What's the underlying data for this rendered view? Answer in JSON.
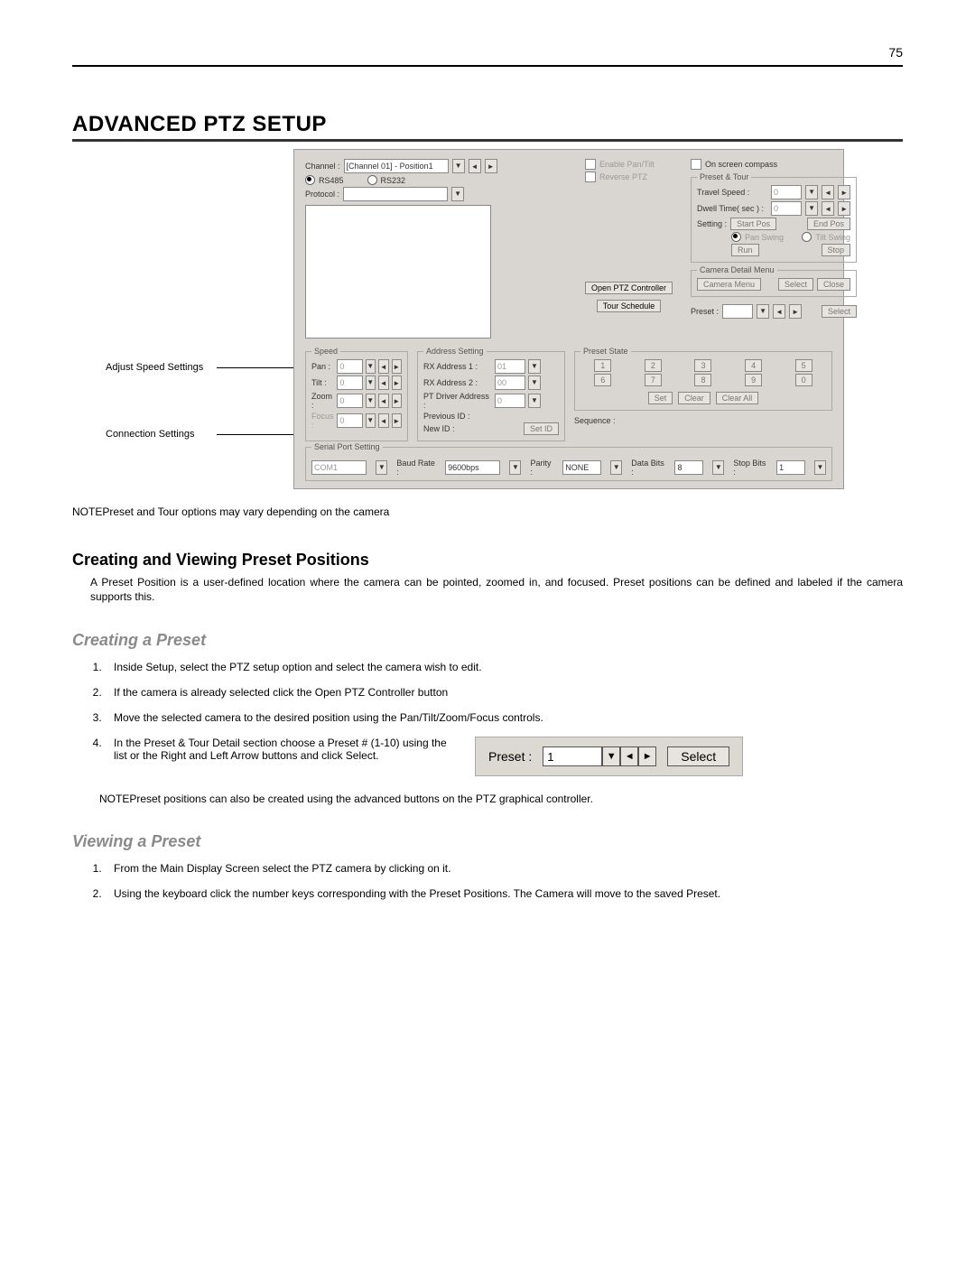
{
  "page_number": "75",
  "h1": "ADVANCED PTZ SETUP",
  "callouts": {
    "speed": "Adjust Speed Settings",
    "conn": "Connection Settings"
  },
  "panel": {
    "channel_label": "Channel :",
    "channel_value": "[Channel 01] - Position1",
    "rs485": "RS485",
    "rs232": "RS232",
    "protocol_label": "Protocol :",
    "enable": "Enable Pan/Tilt",
    "reverse": "Reverse PTZ",
    "compass": "On screen compass",
    "open_ptz": "Open PTZ Controller",
    "tour_schedule": "Tour Schedule",
    "speed": {
      "title": "Speed",
      "pan": "Pan :",
      "tilt": "Tilt :",
      "zoom": "Zoom :",
      "focus": "Focus :",
      "val": "0"
    },
    "address": {
      "title": "Address Setting",
      "rx1": "RX Address 1 :",
      "rx2": "RX Address 2 :",
      "pt": "PT Driver Address :",
      "prev": "Previous ID :",
      "new": "New ID :",
      "setid": "Set ID",
      "v1": "01",
      "v2": "00",
      "v3": "0"
    },
    "preset_tour": {
      "title": "Preset & Tour",
      "travel": "Travel Speed  :",
      "dwell": "Dwell Time( sec )  :",
      "setting": "Setting :",
      "startpos": "Start Pos",
      "endpos": "End Pos",
      "panswing": "Pan Swing",
      "tiltswing": "Tilt Swing",
      "run": "Run",
      "stop": "Stop",
      "val": "0"
    },
    "camera_menu": {
      "title": "Camera Detail Menu",
      "menu": "Camera Menu",
      "select": "Select",
      "close": "Close"
    },
    "preset_label": "Preset :",
    "preset_select": "Select",
    "preset_state": {
      "title": "Preset State",
      "b1": "1",
      "b2": "2",
      "b3": "3",
      "b4": "4",
      "b5": "5",
      "b6": "6",
      "b7": "7",
      "b8": "8",
      "b9": "9",
      "b0": "0",
      "set": "Set",
      "clear": "Clear",
      "clearall": "Clear All"
    },
    "sequence": "Sequence :",
    "serial": {
      "title": "Serial Port Setting",
      "port": "COM1",
      "baud_label": "Baud Rate :",
      "baud": "9600bps",
      "parity_label": "Parity :",
      "parity": "NONE",
      "data_label": "Data Bits :",
      "data": "8",
      "stop_label": "Stop Bits :",
      "stop": "1"
    }
  },
  "note1": "NOTEPreset and Tour options may vary depending on the camera",
  "h2": "Creating and Viewing Preset Positions",
  "p1": "A Preset Position is a user-defined location where the camera can be pointed, zoomed in, and focused.  Preset positions can be defined and labeled if the camera supports this.",
  "h3a": "Creating a Preset",
  "steps_a": {
    "s1": "Inside Setup, select the PTZ setup option and select the camera wish to edit.",
    "s2": "If the camera is already selected click the Open PTZ Controller button",
    "s3": "Move the selected camera to the desired position using the Pan/Tilt/Zoom/Focus controls.",
    "s4": "In the Preset & Tour Detail section choose a Preset # (1-10) using the list or the Right and Left Arrow buttons and click Select."
  },
  "mini": {
    "label": "Preset :",
    "value": "1",
    "select": "Select"
  },
  "note2": "NOTEPreset positions can also be created using the advanced buttons on the PTZ graphical controller.",
  "h3b": "Viewing a Preset",
  "steps_b": {
    "s1": "From the Main Display Screen select the PTZ camera by clicking on it.",
    "s2": "Using the keyboard click the number keys corresponding with the Preset Positions.  The Camera will move to the saved Preset."
  }
}
